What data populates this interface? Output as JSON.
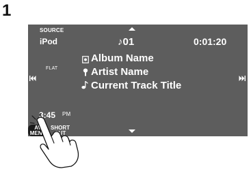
{
  "step_number": "1",
  "display": {
    "source_label": "SOURCE",
    "source_value": "iPod",
    "track_number": "♪01",
    "elapsed_time": "0:01:20",
    "album_name": "Album Name",
    "artist_name": "Artist Name",
    "track_title": "Current Track Title",
    "eq_mode": "FLAT",
    "clock_time": "3:45",
    "clock_period": "PM",
    "prev_glyph": "⏮",
    "next_glyph": "⏭"
  },
  "buttons": {
    "av_menu_line1": "AV",
    "av_menu_line2": "MENU",
    "short_cut_line1": "SHORT",
    "short_cut_line2": "CUT"
  },
  "icons": {
    "album": "album-icon",
    "artist": "artist-icon",
    "track": "music-note-icon",
    "hand": "pointing-hand-icon"
  },
  "colors": {
    "screen_bg": "#5d5d5d",
    "button_bg": "#1b1b1b",
    "text": "#ffffff"
  }
}
